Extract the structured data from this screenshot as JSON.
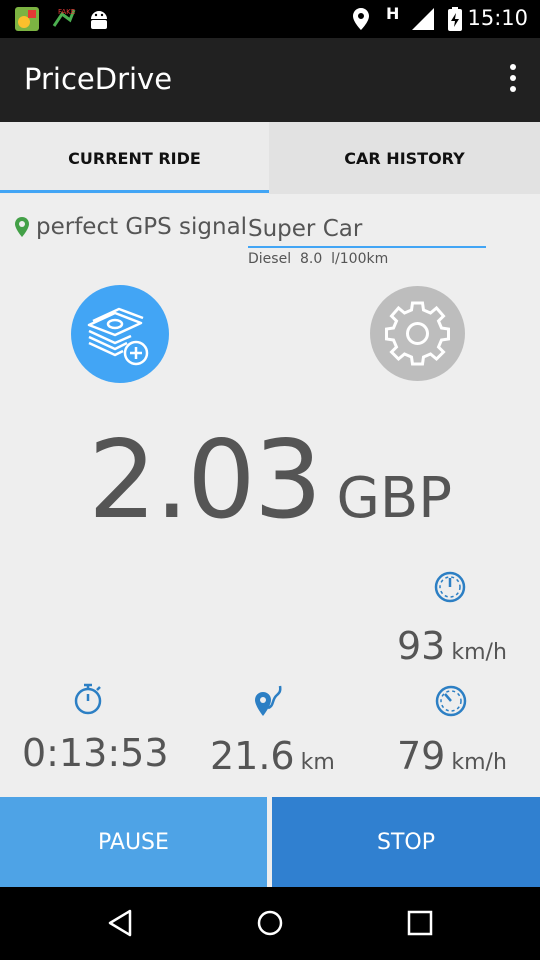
{
  "status_bar": {
    "time": "15:10",
    "signal_letter": "H",
    "icons": [
      "app-icon",
      "fake-gps-icon",
      "android-icon",
      "location-icon",
      "signal-icon",
      "battery-icon"
    ]
  },
  "app_bar": {
    "title": "PriceDrive",
    "menu_icon": "overflow-menu-icon"
  },
  "tabs": [
    {
      "label": "CURRENT RIDE",
      "active": true
    },
    {
      "label": "CAR HISTORY",
      "active": false
    }
  ],
  "gps": {
    "label": "perfect GPS signal",
    "icon": "location-pin-icon",
    "color": "#43a047"
  },
  "car": {
    "name": "Super Car",
    "fuel_type": "Diesel",
    "consumption": "8.0",
    "consumption_unit": "l/100km"
  },
  "actions": {
    "add_money_icon": "money-add-icon",
    "settings_icon": "gear-icon"
  },
  "price": {
    "amount": "2.03",
    "currency": "GBP"
  },
  "stats": {
    "current_speed": {
      "value": "93",
      "unit": "km/h",
      "icon": "speedometer-icon"
    },
    "duration": {
      "value": "0:13:53",
      "icon": "stopwatch-icon"
    },
    "distance": {
      "value": "21.6",
      "unit": "km",
      "icon": "route-icon"
    },
    "avg_speed": {
      "value": "79",
      "unit": "km/h",
      "icon": "speedometer-icon"
    }
  },
  "buttons": {
    "pause": "PAUSE",
    "stop": "STOP"
  },
  "colors": {
    "accent": "#42a5f5",
    "pause": "#4ea3e6",
    "stop": "#3080d0",
    "icon_blue": "#2c7fc4"
  },
  "nav_bar": [
    "back-icon",
    "home-icon",
    "recents-icon"
  ]
}
